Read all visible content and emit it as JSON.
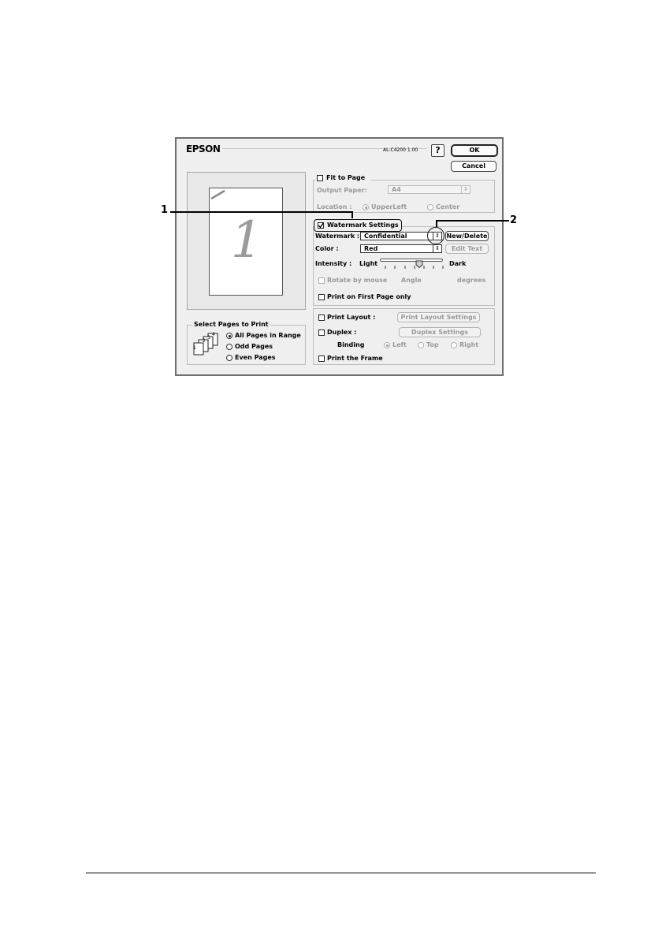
{
  "header": {
    "brand": "EPSON",
    "version": "AL-C4200 1.00",
    "help": "?",
    "ok": "OK",
    "cancel": "Cancel"
  },
  "preview": {
    "page_number": "1"
  },
  "select_pages": {
    "title": "Select Pages to Print",
    "options": [
      "All Pages in Range",
      "Odd Pages",
      "Even Pages"
    ],
    "selected": "All Pages in Range",
    "icon_digits": [
      "1",
      "2",
      "3",
      "4"
    ]
  },
  "fit_to_page": {
    "label": "Fit to Page",
    "checked": false,
    "output_paper_label": "Output Paper:",
    "output_paper_value": "A4",
    "location_label": "Location :",
    "location_options": [
      "UpperLeft",
      "Center"
    ],
    "location_selected": "UpperLeft"
  },
  "watermark_settings": {
    "label": "Watermark Settings",
    "checked": true,
    "watermark_label": "Watermark :",
    "watermark_value": "Confidential",
    "new_delete": "New/Delete",
    "color_label": "Color :",
    "color_value": "Red",
    "edit_text": "Edit Text",
    "intensity_label": "Intensity :",
    "light": "Light",
    "dark": "Dark",
    "intensity_level": 0.62,
    "rotate_label": "Rotate by mouse",
    "angle_label": "Angle",
    "degrees_label": "degrees",
    "first_page_only": "Print on First Page only"
  },
  "layout": {
    "print_layout": "Print Layout :",
    "print_layout_settings": "Print Layout Settings",
    "duplex": "Duplex :",
    "duplex_settings": "Duplex Settings",
    "binding_label": "Binding",
    "binding_options": [
      "Left",
      "Top",
      "Right"
    ],
    "binding_selected": "Left",
    "print_frame": "Print the Frame"
  },
  "callouts": [
    "1",
    "2"
  ]
}
